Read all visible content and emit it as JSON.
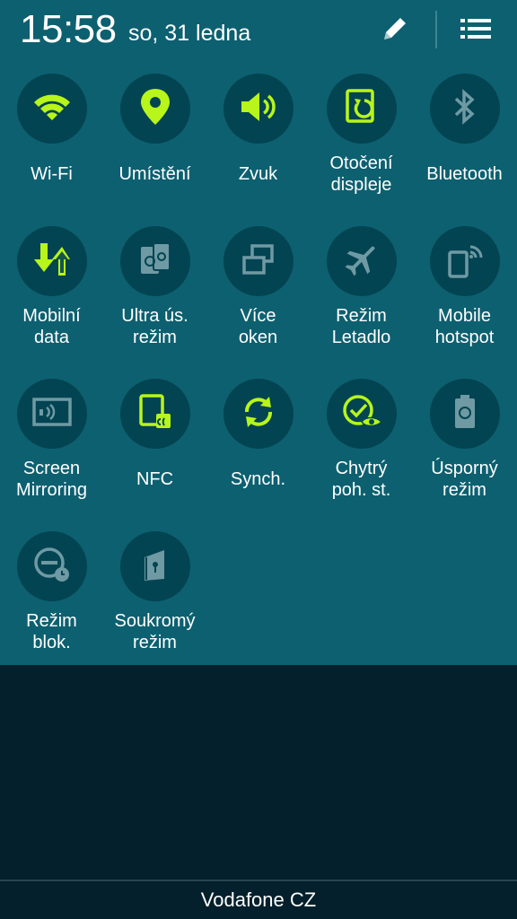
{
  "status": {
    "time": "15:58",
    "date": "so, 31 ledna"
  },
  "colors": {
    "panel": "#0d6070",
    "tile_bg": "#034452",
    "active": "#b8f51a",
    "inactive": "#6f9aa3"
  },
  "tiles": [
    {
      "label": "Wi-Fi",
      "icon": "wifi-icon",
      "active": true
    },
    {
      "label": "Umístění",
      "icon": "location-icon",
      "active": true
    },
    {
      "label": "Zvuk",
      "icon": "volume-icon",
      "active": true
    },
    {
      "label": "Otočení\ndispleje",
      "icon": "screen-rotation-icon",
      "active": true
    },
    {
      "label": "Bluetooth",
      "icon": "bluetooth-icon",
      "active": false
    },
    {
      "label": "Mobilní\ndata",
      "icon": "mobile-data-icon",
      "active": true
    },
    {
      "label": "Ultra ús.\nrežim",
      "icon": "ultra-power-saving-icon",
      "active": false
    },
    {
      "label": "Více\noken",
      "icon": "multi-window-icon",
      "active": false
    },
    {
      "label": "Režim\nLetadlo",
      "icon": "airplane-icon",
      "active": false
    },
    {
      "label": "Mobile\nhotspot",
      "icon": "hotspot-icon",
      "active": false
    },
    {
      "label": "Screen\nMirroring",
      "icon": "screen-mirroring-icon",
      "active": false
    },
    {
      "label": "NFC",
      "icon": "nfc-icon",
      "active": true
    },
    {
      "label": "Synch.",
      "icon": "sync-icon",
      "active": true
    },
    {
      "label": "Chytrý\npoh. st.",
      "icon": "smart-stay-icon",
      "active": true
    },
    {
      "label": "Úsporný\nrežim",
      "icon": "power-saving-icon",
      "active": false
    },
    {
      "label": "Režim\nblok.",
      "icon": "blocking-mode-icon",
      "active": false
    },
    {
      "label": "Soukromý\nrežim",
      "icon": "private-mode-icon",
      "active": false
    }
  ],
  "footer": {
    "carrier": "Vodafone CZ"
  }
}
